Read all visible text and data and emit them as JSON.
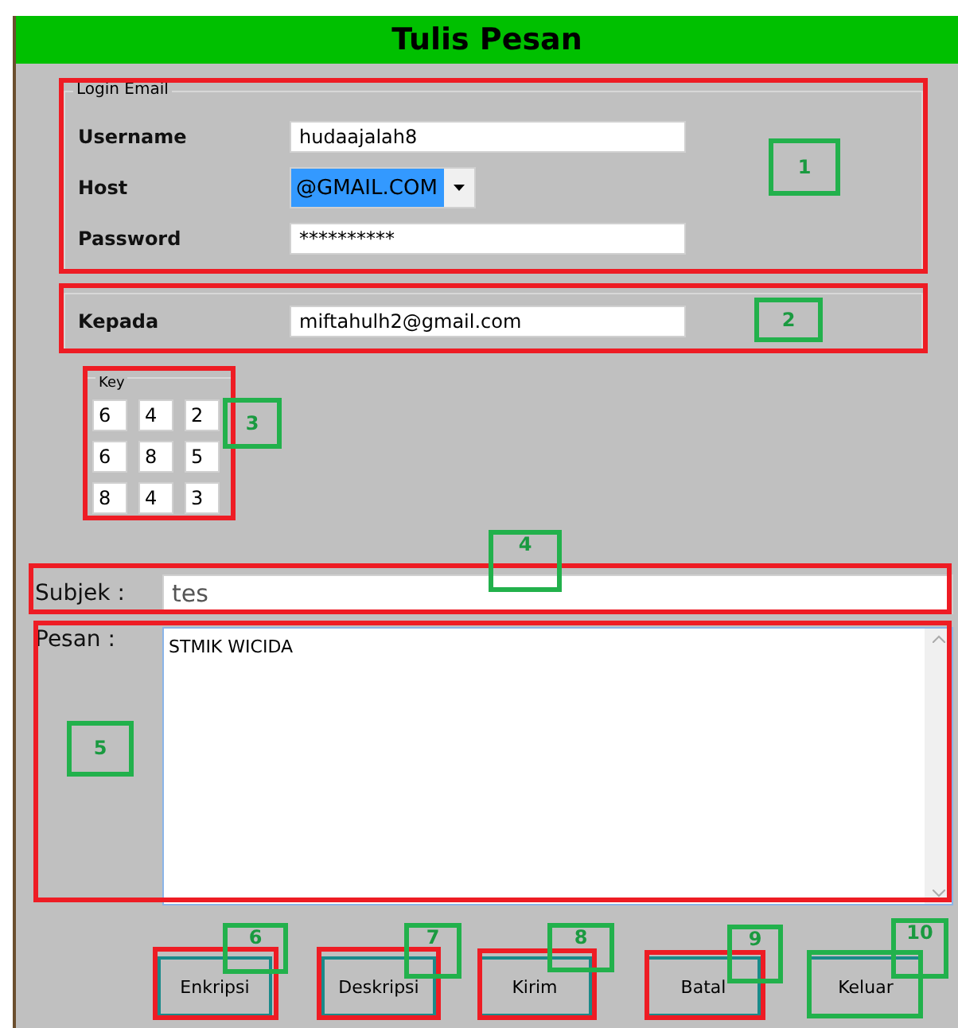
{
  "window": {
    "title": "Tulis Pesan"
  },
  "login_group": {
    "title": "Login Email",
    "fields": [
      {
        "label": "Username",
        "kind": "text",
        "value": "hudaajalah8",
        "focused": false
      },
      {
        "label": "Host",
        "kind": "dropdown",
        "value": "@GMAIL.COM",
        "focused": true
      },
      {
        "label": "Password",
        "kind": "text",
        "value": "**********",
        "focused": false
      }
    ]
  },
  "recipient": {
    "label": "Kepada",
    "value": "miftahulh2@gmail.com"
  },
  "key": {
    "title": "Key",
    "rows": [
      [
        "6",
        "4",
        "2"
      ],
      [
        "6",
        "8",
        "5"
      ],
      [
        "8",
        "4",
        "3"
      ]
    ]
  },
  "subject": {
    "label": "Subjek :",
    "value": "tes"
  },
  "message": {
    "label": "Pesan :",
    "value": "STMIK WICIDA"
  },
  "buttons": [
    "Enkripsi",
    "Deskripsi",
    "Kirim",
    "Batal",
    "Keluar"
  ],
  "callouts": [
    "1",
    "2",
    "3",
    "4",
    "5",
    "6",
    "7",
    "8",
    "9",
    "10"
  ]
}
